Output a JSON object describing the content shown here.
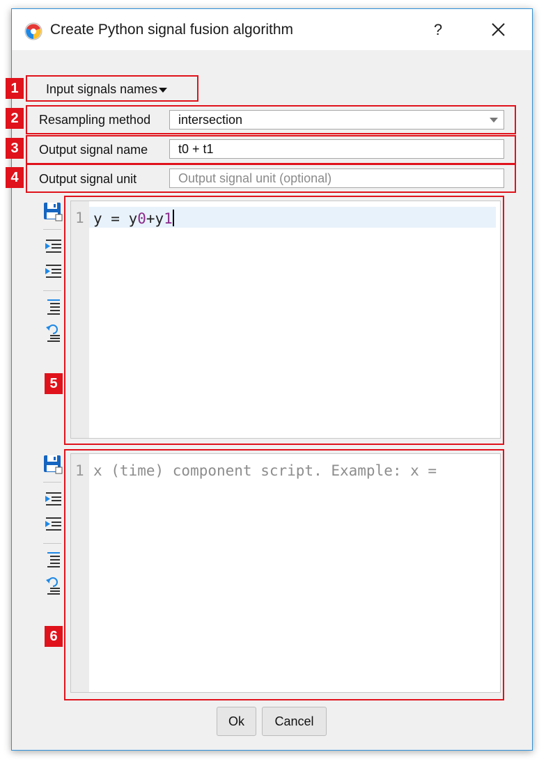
{
  "window": {
    "title": "Create Python signal fusion algorithm",
    "help_label": "?",
    "close_icon": "close-icon"
  },
  "input_signals": {
    "label": "Input signals names"
  },
  "resampling": {
    "label": "Resampling method",
    "value": "intersection"
  },
  "output_name": {
    "label": "Output signal name",
    "value": "t0 + t1"
  },
  "output_unit": {
    "label": "Output signal unit",
    "placeholder": "Output signal unit (optional)"
  },
  "y_editor": {
    "line_number": "1",
    "code_prefix": "y = y",
    "code_n0": "0",
    "code_mid": "+y",
    "code_n1": "1"
  },
  "x_editor": {
    "line_number": "1",
    "placeholder": "x (time) component script. Example: x ="
  },
  "annotations": [
    "1",
    "2",
    "3",
    "4",
    "5",
    "6"
  ],
  "buttons": {
    "ok": "Ok",
    "cancel": "Cancel"
  },
  "colors": {
    "annotation_red": "#e0121b",
    "accent_blue": "#1565c0",
    "window_border": "#2f8fd8"
  }
}
